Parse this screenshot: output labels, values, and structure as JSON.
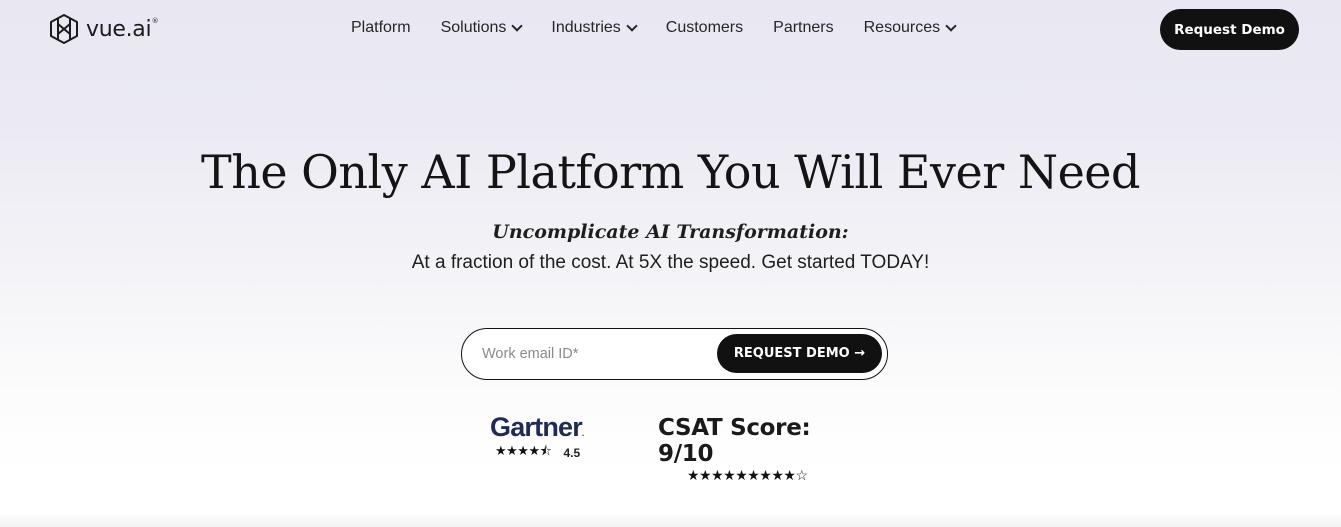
{
  "header": {
    "logo_text": "vue.ai",
    "logo_reg": "®",
    "nav": [
      {
        "label": "Platform",
        "has_dropdown": false
      },
      {
        "label": "Solutions",
        "has_dropdown": true
      },
      {
        "label": "Industries",
        "has_dropdown": true
      },
      {
        "label": "Customers",
        "has_dropdown": false
      },
      {
        "label": "Partners",
        "has_dropdown": false
      },
      {
        "label": "Resources",
        "has_dropdown": true
      }
    ],
    "cta_label": "Request Demo"
  },
  "hero": {
    "title": "The Only AI Platform You Will Ever Need",
    "subtitle": "Uncomplicate AI Transformation:",
    "description": "At a fraction of the cost. At 5X the speed. Get started TODAY!"
  },
  "form": {
    "email_placeholder": "Work email ID*",
    "email_value": "",
    "submit_label": "REQUEST DEMO →"
  },
  "ratings": {
    "gartner": {
      "logo_text": "Gartner",
      "logo_dot": ".",
      "stars_display": "★★★★⯪",
      "rating": "4.5",
      "rating_value": 4.5,
      "max": 5
    },
    "csat": {
      "title": "CSAT Score: 9/10",
      "stars_display": "★★★★★★★★★☆",
      "score": 9,
      "max": 10
    }
  },
  "colors": {
    "primary_button": "#111111",
    "gartner_blue": "#1f2a56",
    "text": "#141414"
  }
}
